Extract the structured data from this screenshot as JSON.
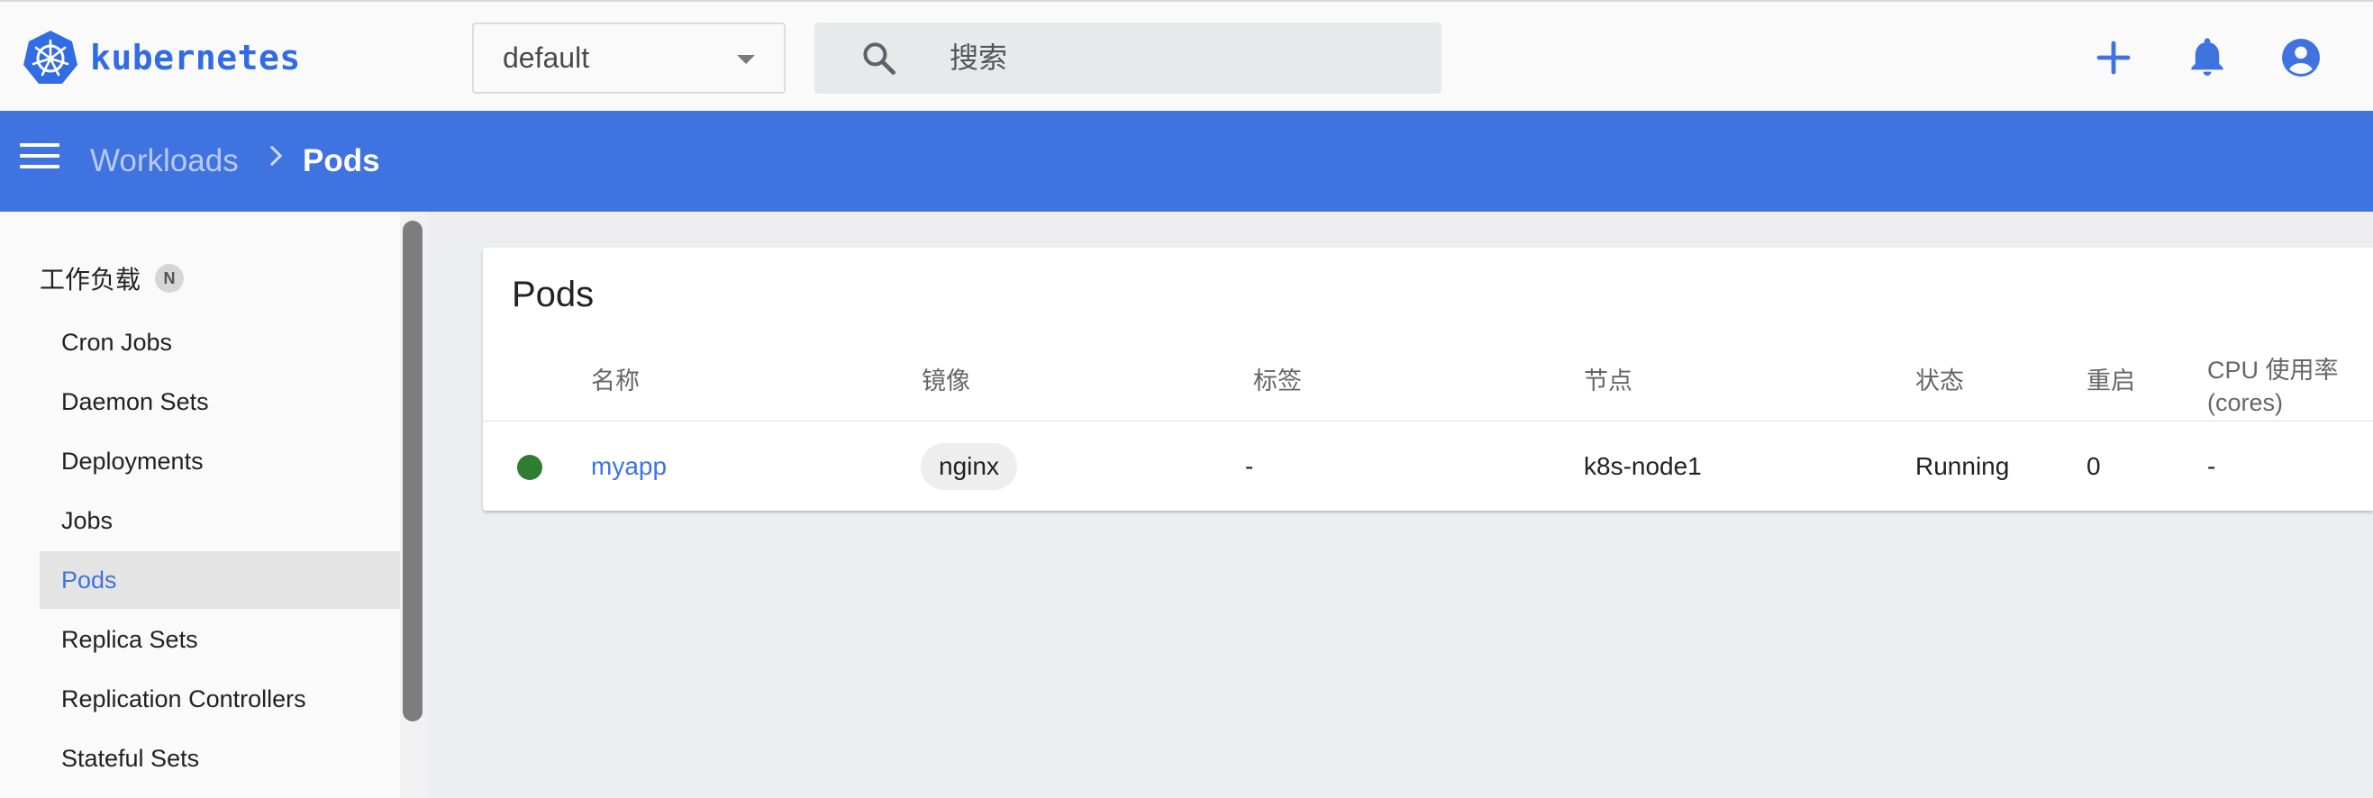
{
  "app": {
    "title": "kubernetes",
    "brand_color": "#326ce5"
  },
  "topbar": {
    "namespace": "default",
    "search_placeholder": "搜索",
    "icons": [
      "add-icon",
      "bell-icon",
      "account-icon"
    ]
  },
  "breadcrumb": {
    "parent": "Workloads",
    "current": "Pods"
  },
  "sidebar": {
    "section": "工作负载",
    "badge": "N",
    "items": [
      {
        "label": "Cron Jobs"
      },
      {
        "label": "Daemon Sets"
      },
      {
        "label": "Deployments"
      },
      {
        "label": "Jobs"
      },
      {
        "label": "Pods",
        "active": true
      },
      {
        "label": "Replica Sets"
      },
      {
        "label": "Replication Controllers"
      },
      {
        "label": "Stateful Sets"
      }
    ]
  },
  "pods": {
    "title": "Pods",
    "columns": {
      "name": "名称",
      "image": "镜像",
      "labels": "标签",
      "node": "节点",
      "status": "状态",
      "restarts": "重启",
      "cpu_line1": "CPU 使用率",
      "cpu_line2": "(cores)"
    },
    "rows": [
      {
        "status_color": "#2e7d32",
        "name": "myapp",
        "image": "nginx",
        "labels": "-",
        "node": "k8s-node1",
        "status": "Running",
        "restarts": "0",
        "cpu": "-"
      }
    ]
  }
}
